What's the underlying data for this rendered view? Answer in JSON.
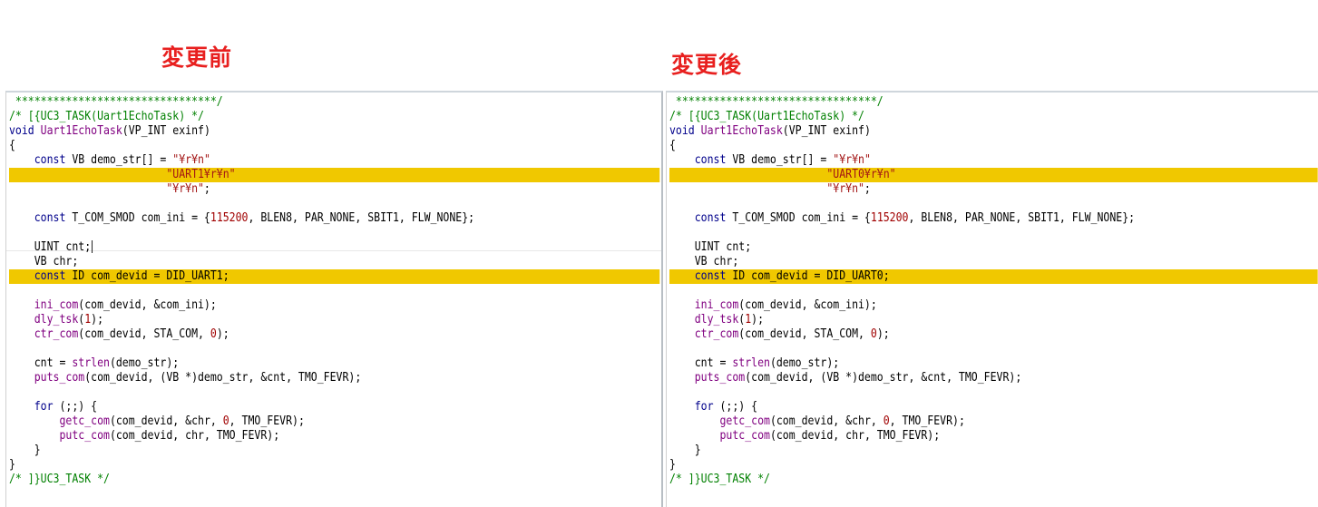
{
  "headings": {
    "before": "変更前",
    "after": "変更後"
  },
  "colors": {
    "heading": "#e8201f",
    "highlight": "#f0c800",
    "keyword": "#00008b",
    "comment": "#008000",
    "function": "#800080",
    "number": "#a00000",
    "string": "#a31515"
  },
  "panes": [
    {
      "name": "before",
      "lines": [
        {
          "hl": false,
          "tokens": [
            {
              "t": "comment",
              "s": " ********************************/"
            }
          ]
        },
        {
          "hl": false,
          "tokens": [
            {
              "t": "comment",
              "s": "/* [{UC3_TASK(Uart1EchoTask) */"
            }
          ]
        },
        {
          "hl": false,
          "tokens": [
            {
              "t": "keyword",
              "s": "void"
            },
            {
              "t": "plain",
              "s": " "
            },
            {
              "t": "func",
              "s": "Uart1EchoTask"
            },
            {
              "t": "plain",
              "s": "(VP_INT exinf)"
            }
          ]
        },
        {
          "hl": false,
          "tokens": [
            {
              "t": "plain",
              "s": "{"
            }
          ]
        },
        {
          "hl": false,
          "tokens": [
            {
              "t": "plain",
              "s": "    "
            },
            {
              "t": "keyword",
              "s": "const"
            },
            {
              "t": "plain",
              "s": " VB demo_str[] = "
            },
            {
              "t": "string",
              "s": "\"¥r¥n\""
            }
          ]
        },
        {
          "hl": true,
          "tokens": [
            {
              "t": "plain",
              "s": "                         "
            },
            {
              "t": "string",
              "s": "\"UART1¥r¥n\""
            }
          ]
        },
        {
          "hl": false,
          "tokens": [
            {
              "t": "plain",
              "s": "                         "
            },
            {
              "t": "string",
              "s": "\"¥r¥n\""
            },
            {
              "t": "plain",
              "s": ";"
            }
          ]
        },
        {
          "hl": false,
          "tokens": []
        },
        {
          "hl": false,
          "tokens": [
            {
              "t": "plain",
              "s": "    "
            },
            {
              "t": "keyword",
              "s": "const"
            },
            {
              "t": "plain",
              "s": " T_COM_SMOD com_ini = {"
            },
            {
              "t": "number",
              "s": "115200"
            },
            {
              "t": "plain",
              "s": ", BLEN8, PAR_NONE, SBIT1, FLW_NONE};"
            }
          ]
        },
        {
          "hl": false,
          "tokens": []
        },
        {
          "hl": false,
          "tokens": [
            {
              "t": "plain",
              "s": "    UINT cnt;"
            }
          ],
          "caret": true
        },
        {
          "hl": false,
          "tokens": [
            {
              "t": "plain",
              "s": "    VB chr;"
            }
          ]
        },
        {
          "hl": true,
          "tokens": [
            {
              "t": "plain",
              "s": "    "
            },
            {
              "t": "keyword",
              "s": "const"
            },
            {
              "t": "plain",
              "s": " ID com_devid = DID_UART1;"
            }
          ]
        },
        {
          "hl": false,
          "tokens": []
        },
        {
          "hl": false,
          "tokens": [
            {
              "t": "plain",
              "s": "    "
            },
            {
              "t": "func",
              "s": "ini_com"
            },
            {
              "t": "plain",
              "s": "(com_devid, &com_ini);"
            }
          ]
        },
        {
          "hl": false,
          "tokens": [
            {
              "t": "plain",
              "s": "    "
            },
            {
              "t": "func",
              "s": "dly_tsk"
            },
            {
              "t": "plain",
              "s": "("
            },
            {
              "t": "number",
              "s": "1"
            },
            {
              "t": "plain",
              "s": ");"
            }
          ]
        },
        {
          "hl": false,
          "tokens": [
            {
              "t": "plain",
              "s": "    "
            },
            {
              "t": "func",
              "s": "ctr_com"
            },
            {
              "t": "plain",
              "s": "(com_devid, STA_COM, "
            },
            {
              "t": "number",
              "s": "0"
            },
            {
              "t": "plain",
              "s": ");"
            }
          ]
        },
        {
          "hl": false,
          "tokens": []
        },
        {
          "hl": false,
          "tokens": [
            {
              "t": "plain",
              "s": "    cnt = "
            },
            {
              "t": "func",
              "s": "strlen"
            },
            {
              "t": "plain",
              "s": "(demo_str);"
            }
          ]
        },
        {
          "hl": false,
          "tokens": [
            {
              "t": "plain",
              "s": "    "
            },
            {
              "t": "func",
              "s": "puts_com"
            },
            {
              "t": "plain",
              "s": "(com_devid, (VB *)demo_str, &cnt, TMO_FEVR);"
            }
          ]
        },
        {
          "hl": false,
          "tokens": []
        },
        {
          "hl": false,
          "tokens": [
            {
              "t": "plain",
              "s": "    "
            },
            {
              "t": "keyword",
              "s": "for"
            },
            {
              "t": "plain",
              "s": " (;;) {"
            }
          ]
        },
        {
          "hl": false,
          "tokens": [
            {
              "t": "plain",
              "s": "        "
            },
            {
              "t": "func",
              "s": "getc_com"
            },
            {
              "t": "plain",
              "s": "(com_devid, &chr, "
            },
            {
              "t": "number",
              "s": "0"
            },
            {
              "t": "plain",
              "s": ", TMO_FEVR);"
            }
          ]
        },
        {
          "hl": false,
          "tokens": [
            {
              "t": "plain",
              "s": "        "
            },
            {
              "t": "func",
              "s": "putc_com"
            },
            {
              "t": "plain",
              "s": "(com_devid, chr, TMO_FEVR);"
            }
          ]
        },
        {
          "hl": false,
          "tokens": [
            {
              "t": "plain",
              "s": "    }"
            }
          ]
        },
        {
          "hl": false,
          "tokens": [
            {
              "t": "plain",
              "s": "}"
            }
          ]
        },
        {
          "hl": false,
          "tokens": [
            {
              "t": "comment",
              "s": "/* ]}UC3_TASK */"
            }
          ]
        }
      ]
    },
    {
      "name": "after",
      "lines": [
        {
          "hl": false,
          "tokens": [
            {
              "t": "comment",
              "s": " ********************************/"
            }
          ]
        },
        {
          "hl": false,
          "tokens": [
            {
              "t": "comment",
              "s": "/* [{UC3_TASK(Uart1EchoTask) */"
            }
          ]
        },
        {
          "hl": false,
          "tokens": [
            {
              "t": "keyword",
              "s": "void"
            },
            {
              "t": "plain",
              "s": " "
            },
            {
              "t": "func",
              "s": "Uart1EchoTask"
            },
            {
              "t": "plain",
              "s": "(VP_INT exinf)"
            }
          ]
        },
        {
          "hl": false,
          "tokens": [
            {
              "t": "plain",
              "s": "{"
            }
          ]
        },
        {
          "hl": false,
          "tokens": [
            {
              "t": "plain",
              "s": "    "
            },
            {
              "t": "keyword",
              "s": "const"
            },
            {
              "t": "plain",
              "s": " VB demo_str[] = "
            },
            {
              "t": "string",
              "s": "\"¥r¥n\""
            }
          ]
        },
        {
          "hl": true,
          "tokens": [
            {
              "t": "plain",
              "s": "                         "
            },
            {
              "t": "string",
              "s": "\"UART0¥r¥n\""
            }
          ]
        },
        {
          "hl": false,
          "tokens": [
            {
              "t": "plain",
              "s": "                         "
            },
            {
              "t": "string",
              "s": "\"¥r¥n\""
            },
            {
              "t": "plain",
              "s": ";"
            }
          ]
        },
        {
          "hl": false,
          "tokens": []
        },
        {
          "hl": false,
          "tokens": [
            {
              "t": "plain",
              "s": "    "
            },
            {
              "t": "keyword",
              "s": "const"
            },
            {
              "t": "plain",
              "s": " T_COM_SMOD com_ini = {"
            },
            {
              "t": "number",
              "s": "115200"
            },
            {
              "t": "plain",
              "s": ", BLEN8, PAR_NONE, SBIT1, FLW_NONE};"
            }
          ]
        },
        {
          "hl": false,
          "tokens": []
        },
        {
          "hl": false,
          "tokens": [
            {
              "t": "plain",
              "s": "    UINT cnt;"
            }
          ]
        },
        {
          "hl": false,
          "tokens": [
            {
              "t": "plain",
              "s": "    VB chr;"
            }
          ]
        },
        {
          "hl": true,
          "tokens": [
            {
              "t": "plain",
              "s": "    "
            },
            {
              "t": "keyword",
              "s": "const"
            },
            {
              "t": "plain",
              "s": " ID com_devid = DID_UART0;"
            }
          ]
        },
        {
          "hl": false,
          "tokens": []
        },
        {
          "hl": false,
          "tokens": [
            {
              "t": "plain",
              "s": "    "
            },
            {
              "t": "func",
              "s": "ini_com"
            },
            {
              "t": "plain",
              "s": "(com_devid, &com_ini);"
            }
          ]
        },
        {
          "hl": false,
          "tokens": [
            {
              "t": "plain",
              "s": "    "
            },
            {
              "t": "func",
              "s": "dly_tsk"
            },
            {
              "t": "plain",
              "s": "("
            },
            {
              "t": "number",
              "s": "1"
            },
            {
              "t": "plain",
              "s": ");"
            }
          ]
        },
        {
          "hl": false,
          "tokens": [
            {
              "t": "plain",
              "s": "    "
            },
            {
              "t": "func",
              "s": "ctr_com"
            },
            {
              "t": "plain",
              "s": "(com_devid, STA_COM, "
            },
            {
              "t": "number",
              "s": "0"
            },
            {
              "t": "plain",
              "s": ");"
            }
          ]
        },
        {
          "hl": false,
          "tokens": []
        },
        {
          "hl": false,
          "tokens": [
            {
              "t": "plain",
              "s": "    cnt = "
            },
            {
              "t": "func",
              "s": "strlen"
            },
            {
              "t": "plain",
              "s": "(demo_str);"
            }
          ]
        },
        {
          "hl": false,
          "tokens": [
            {
              "t": "plain",
              "s": "    "
            },
            {
              "t": "func",
              "s": "puts_com"
            },
            {
              "t": "plain",
              "s": "(com_devid, (VB *)demo_str, &cnt, TMO_FEVR);"
            }
          ]
        },
        {
          "hl": false,
          "tokens": []
        },
        {
          "hl": false,
          "tokens": [
            {
              "t": "plain",
              "s": "    "
            },
            {
              "t": "keyword",
              "s": "for"
            },
            {
              "t": "plain",
              "s": " (;;) {"
            }
          ]
        },
        {
          "hl": false,
          "tokens": [
            {
              "t": "plain",
              "s": "        "
            },
            {
              "t": "func",
              "s": "getc_com"
            },
            {
              "t": "plain",
              "s": "(com_devid, &chr, "
            },
            {
              "t": "number",
              "s": "0"
            },
            {
              "t": "plain",
              "s": ", TMO_FEVR);"
            }
          ]
        },
        {
          "hl": false,
          "tokens": [
            {
              "t": "plain",
              "s": "        "
            },
            {
              "t": "func",
              "s": "putc_com"
            },
            {
              "t": "plain",
              "s": "(com_devid, chr, TMO_FEVR);"
            }
          ]
        },
        {
          "hl": false,
          "tokens": [
            {
              "t": "plain",
              "s": "    }"
            }
          ]
        },
        {
          "hl": false,
          "tokens": [
            {
              "t": "plain",
              "s": "}"
            }
          ]
        },
        {
          "hl": false,
          "tokens": [
            {
              "t": "comment",
              "s": "/* ]}UC3_TASK */"
            }
          ]
        }
      ]
    }
  ]
}
